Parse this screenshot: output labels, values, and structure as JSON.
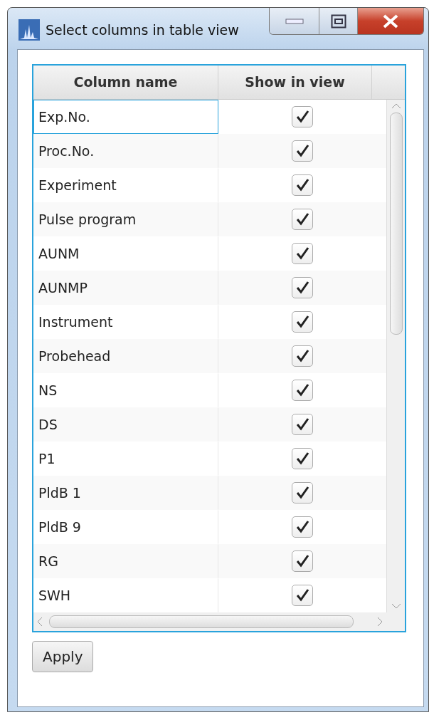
{
  "window": {
    "title": "Select columns in table view"
  },
  "table": {
    "columns": [
      "Column name",
      "Show in view"
    ],
    "rows": [
      {
        "name": "Exp.No.",
        "show": true,
        "selected": true
      },
      {
        "name": "Proc.No.",
        "show": true,
        "selected": false
      },
      {
        "name": "Experiment",
        "show": true,
        "selected": false
      },
      {
        "name": "Pulse program",
        "show": true,
        "selected": false
      },
      {
        "name": "AUNM",
        "show": true,
        "selected": false
      },
      {
        "name": "AUNMP",
        "show": true,
        "selected": false
      },
      {
        "name": "Instrument",
        "show": true,
        "selected": false
      },
      {
        "name": "Probehead",
        "show": true,
        "selected": false
      },
      {
        "name": "NS",
        "show": true,
        "selected": false
      },
      {
        "name": "DS",
        "show": true,
        "selected": false
      },
      {
        "name": "P1",
        "show": true,
        "selected": false
      },
      {
        "name": "PldB 1",
        "show": true,
        "selected": false
      },
      {
        "name": "PldB 9",
        "show": true,
        "selected": false
      },
      {
        "name": "RG",
        "show": true,
        "selected": false
      },
      {
        "name": "SWH",
        "show": true,
        "selected": false
      }
    ]
  },
  "buttons": [
    "Apply"
  ]
}
